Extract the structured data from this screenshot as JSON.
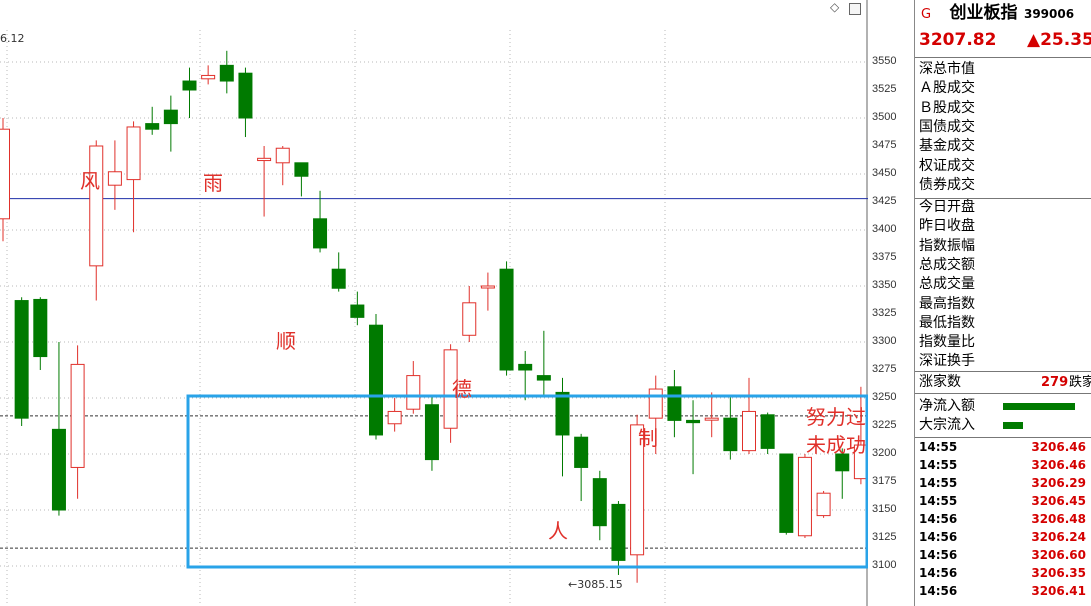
{
  "chart_data": {
    "type": "candlestick",
    "ylim": [
      3090,
      3570
    ],
    "yticks": [
      3100,
      3125,
      3150,
      3175,
      3200,
      3225,
      3250,
      3275,
      3300,
      3325,
      3350,
      3375,
      3400,
      3425,
      3450,
      3475,
      3500,
      3525,
      3550
    ],
    "reference_lines": [
      3428,
      3234,
      3116
    ],
    "top_label": "6.12",
    "low_marker": "3085.15",
    "candles": [
      {
        "o": 3410,
        "c": 3490,
        "h": 3500,
        "l": 3390
      },
      {
        "o": 3337,
        "c": 3232,
        "h": 3340,
        "l": 3225
      },
      {
        "o": 3338,
        "c": 3287,
        "h": 3340,
        "l": 3275
      },
      {
        "o": 3222,
        "c": 3150,
        "h": 3300,
        "l": 3145
      },
      {
        "o": 3188,
        "c": 3280,
        "h": 3297,
        "l": 3160
      },
      {
        "o": 3368,
        "c": 3475,
        "h": 3480,
        "l": 3337
      },
      {
        "o": 3440,
        "c": 3452,
        "h": 3480,
        "l": 3418
      },
      {
        "o": 3445,
        "c": 3492,
        "h": 3497,
        "l": 3398
      },
      {
        "o": 3495,
        "c": 3490,
        "h": 3510,
        "l": 3485
      },
      {
        "o": 3507,
        "c": 3495,
        "h": 3520,
        "l": 3470
      },
      {
        "o": 3533,
        "c": 3525,
        "h": 3545,
        "l": 3500
      },
      {
        "o": 3535,
        "c": 3538,
        "h": 3547,
        "l": 3530
      },
      {
        "o": 3547,
        "c": 3533,
        "h": 3560,
        "l": 3522
      },
      {
        "o": 3540,
        "c": 3500,
        "h": 3545,
        "l": 3483
      },
      {
        "o": 3462,
        "c": 3464,
        "h": 3475,
        "l": 3412
      },
      {
        "o": 3460,
        "c": 3473,
        "h": 3475,
        "l": 3440
      },
      {
        "o": 3460,
        "c": 3448,
        "h": 3460,
        "l": 3430
      },
      {
        "o": 3410,
        "c": 3384,
        "h": 3435,
        "l": 3380
      },
      {
        "o": 3365,
        "c": 3348,
        "h": 3380,
        "l": 3345
      },
      {
        "o": 3333,
        "c": 3322,
        "h": 3345,
        "l": 3315
      },
      {
        "o": 3315,
        "c": 3217,
        "h": 3325,
        "l": 3213
      },
      {
        "o": 3227,
        "c": 3238,
        "h": 3250,
        "l": 3220
      },
      {
        "o": 3240,
        "c": 3270,
        "h": 3283,
        "l": 3236
      },
      {
        "o": 3244,
        "c": 3195,
        "h": 3252,
        "l": 3185
      },
      {
        "o": 3223,
        "c": 3293,
        "h": 3298,
        "l": 3210
      },
      {
        "o": 3306,
        "c": 3335,
        "h": 3350,
        "l": 3300
      },
      {
        "o": 3350,
        "c": 3350,
        "h": 3362,
        "l": 3328
      },
      {
        "o": 3365,
        "c": 3275,
        "h": 3372,
        "l": 3270
      },
      {
        "o": 3280,
        "c": 3275,
        "h": 3292,
        "l": 3248
      },
      {
        "o": 3270,
        "c": 3266,
        "h": 3310,
        "l": 3252
      },
      {
        "o": 3255,
        "c": 3217,
        "h": 3268,
        "l": 3180
      },
      {
        "o": 3215,
        "c": 3188,
        "h": 3218,
        "l": 3158
      },
      {
        "o": 3178,
        "c": 3136,
        "h": 3185,
        "l": 3123
      },
      {
        "o": 3155,
        "c": 3105,
        "h": 3158,
        "l": 3092
      },
      {
        "o": 3110,
        "c": 3226,
        "h": 3235,
        "l": 3085
      },
      {
        "o": 3232,
        "c": 3258,
        "h": 3270,
        "l": 3200
      },
      {
        "o": 3260,
        "c": 3230,
        "h": 3275,
        "l": 3215
      },
      {
        "o": 3230,
        "c": 3228,
        "h": 3248,
        "l": 3182
      },
      {
        "o": 3232,
        "c": 3232,
        "h": 3255,
        "l": 3215
      },
      {
        "o": 3232,
        "c": 3203,
        "h": 3252,
        "l": 3195
      },
      {
        "o": 3203,
        "c": 3238,
        "h": 3268,
        "l": 3200
      },
      {
        "o": 3235,
        "c": 3205,
        "h": 3237,
        "l": 3200
      },
      {
        "o": 3200,
        "c": 3130,
        "h": 3200,
        "l": 3128
      },
      {
        "o": 3127,
        "c": 3197,
        "h": 3200,
        "l": 3125
      },
      {
        "o": 3145,
        "c": 3165,
        "h": 3167,
        "l": 3143
      },
      {
        "o": 3200,
        "c": 3185,
        "h": 3205,
        "l": 3160
      },
      {
        "o": 3178,
        "c": 3208,
        "h": 3260,
        "l": 3173
      }
    ]
  },
  "annotations": [
    {
      "text": "风"
    },
    {
      "text": "雨"
    },
    {
      "text": "顺"
    },
    {
      "text": "德"
    },
    {
      "text": "人"
    },
    {
      "text": "制"
    },
    {
      "text": "努力过"
    },
    {
      "text": "未成功"
    }
  ],
  "panel": {
    "icon_letter": "G",
    "name": "创业板指",
    "code": "399006",
    "price": "3207.82",
    "change": "▲25.35",
    "colors": {
      "up": "#d40000",
      "down": "#007a00",
      "accent_blue": "#29a3e8"
    },
    "stats_labels": [
      "深总市值",
      "Ａ股成交",
      "Ｂ股成交",
      "国债成交",
      "基金成交",
      "权证成交",
      "债券成交",
      "今日开盘",
      "昨日收盘",
      "指数振幅",
      "总成交额",
      "总成交量",
      "最高指数",
      "最低指数",
      "指数量比",
      "深证换手"
    ],
    "rise_label": "涨家数",
    "rise_count": "279",
    "fall_label": "跌家",
    "flow_labels": [
      "净流入额",
      "大宗流入"
    ],
    "flow_values": [
      0.72,
      0.2
    ],
    "ticks": [
      {
        "time": "14:55",
        "price": "3206.46"
      },
      {
        "time": "14:55",
        "price": "3206.46"
      },
      {
        "time": "14:55",
        "price": "3206.29"
      },
      {
        "time": "14:55",
        "price": "3206.45"
      },
      {
        "time": "14:56",
        "price": "3206.48"
      },
      {
        "time": "14:56",
        "price": "3206.24"
      },
      {
        "time": "14:56",
        "price": "3206.60"
      },
      {
        "time": "14:56",
        "price": "3206.35"
      },
      {
        "time": "14:56",
        "price": "3206.41"
      }
    ]
  }
}
